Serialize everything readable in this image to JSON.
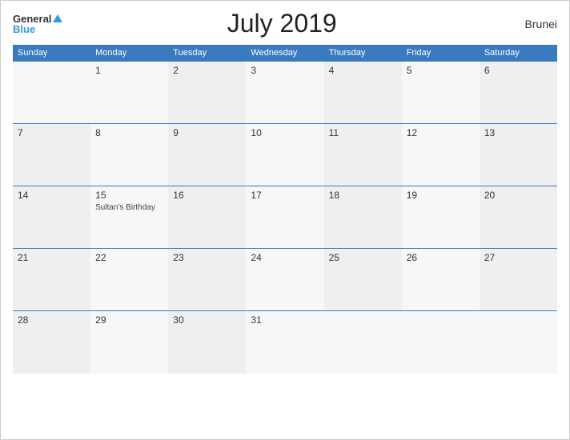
{
  "header": {
    "logo_general": "General",
    "logo_blue": "Blue",
    "title": "July 2019",
    "country": "Brunei"
  },
  "days_of_week": [
    "Sunday",
    "Monday",
    "Tuesday",
    "Wednesday",
    "Thursday",
    "Friday",
    "Saturday"
  ],
  "weeks": [
    [
      {
        "day": "",
        "event": ""
      },
      {
        "day": "1",
        "event": ""
      },
      {
        "day": "2",
        "event": ""
      },
      {
        "day": "3",
        "event": ""
      },
      {
        "day": "4",
        "event": ""
      },
      {
        "day": "5",
        "event": ""
      },
      {
        "day": "6",
        "event": ""
      }
    ],
    [
      {
        "day": "7",
        "event": ""
      },
      {
        "day": "8",
        "event": ""
      },
      {
        "day": "9",
        "event": ""
      },
      {
        "day": "10",
        "event": ""
      },
      {
        "day": "11",
        "event": ""
      },
      {
        "day": "12",
        "event": ""
      },
      {
        "day": "13",
        "event": ""
      }
    ],
    [
      {
        "day": "14",
        "event": ""
      },
      {
        "day": "15",
        "event": "Sultan's Birthday"
      },
      {
        "day": "16",
        "event": ""
      },
      {
        "day": "17",
        "event": ""
      },
      {
        "day": "18",
        "event": ""
      },
      {
        "day": "19",
        "event": ""
      },
      {
        "day": "20",
        "event": ""
      }
    ],
    [
      {
        "day": "21",
        "event": ""
      },
      {
        "day": "22",
        "event": ""
      },
      {
        "day": "23",
        "event": ""
      },
      {
        "day": "24",
        "event": ""
      },
      {
        "day": "25",
        "event": ""
      },
      {
        "day": "26",
        "event": ""
      },
      {
        "day": "27",
        "event": ""
      }
    ],
    [
      {
        "day": "28",
        "event": ""
      },
      {
        "day": "29",
        "event": ""
      },
      {
        "day": "30",
        "event": ""
      },
      {
        "day": "31",
        "event": ""
      },
      {
        "day": "",
        "event": ""
      },
      {
        "day": "",
        "event": ""
      },
      {
        "day": "",
        "event": ""
      }
    ]
  ]
}
